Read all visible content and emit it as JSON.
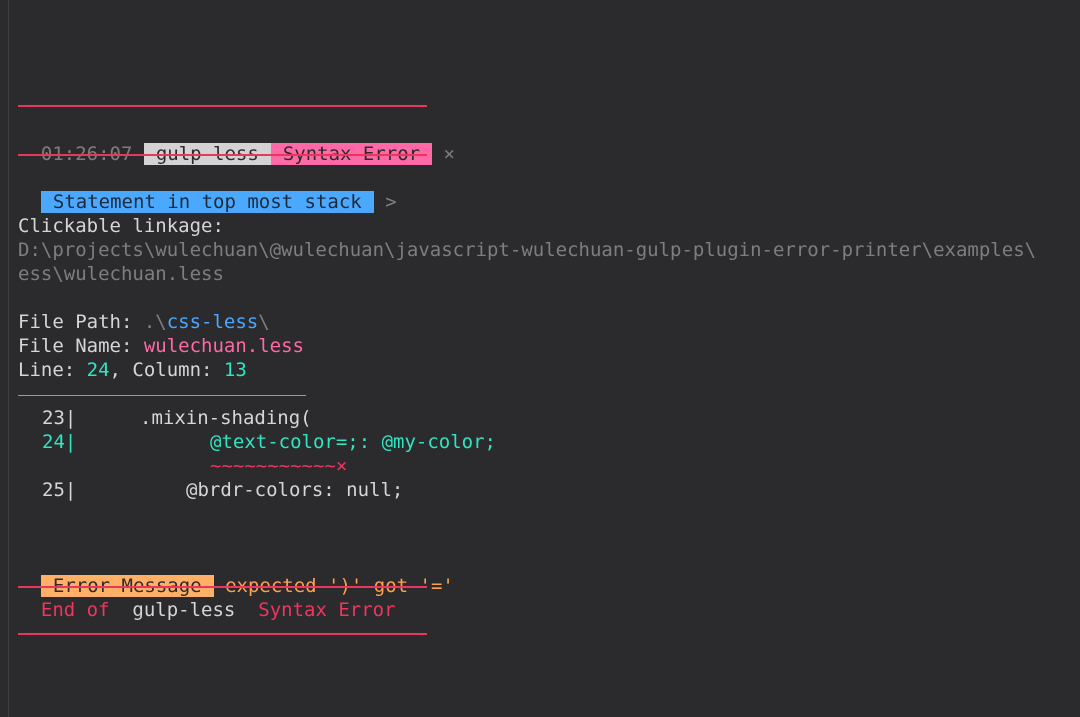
{
  "header": {
    "time": "01:26:07",
    "plugin": "gulp-less",
    "error_type": "Syntax Error",
    "close_glyph": "×"
  },
  "stack": {
    "label": "Statement in top most stack",
    "arrow": ">"
  },
  "linkage": {
    "label": "Clickable linkage:",
    "line1": "D:\\projects\\wulechuan\\@wulechuan\\javascript-wulechuan-gulp-plugin-error-printer\\examples\\",
    "line2": "ess\\wulechuan.less"
  },
  "file": {
    "path_label": "File Path: ",
    "path_dot": ".\\",
    "path_dir": "css-less",
    "path_tail": "\\",
    "name_label": "File Name: ",
    "name_value": "wulechuan.less",
    "line_label": "Line: ",
    "line_value": "24",
    "column_sep": ", Column: ",
    "column_value": "13"
  },
  "code": {
    "lines": [
      {
        "num": "23|",
        "text": ".mixin-shading("
      },
      {
        "num": "24|",
        "text": "@text-color=;: @my-color;"
      },
      {
        "num": "",
        "text": "~~~~~~~~~~~"
      },
      {
        "num": "25|",
        "text": "@brdr-colors: null;"
      }
    ],
    "error_mark": "×"
  },
  "message": {
    "label": "Error Message",
    "text": "expected ')' got '='"
  },
  "footer": {
    "end_of": "End of",
    "plugin": "gulp-less",
    "error_type": "Syntax Error"
  },
  "colors": {
    "background": "#2b2b2d",
    "rule": "#e8365e",
    "pink": "#ff6aa6",
    "blue": "#4aa8ff",
    "teal": "#2ee6c2",
    "orange": "#ffa24d"
  }
}
